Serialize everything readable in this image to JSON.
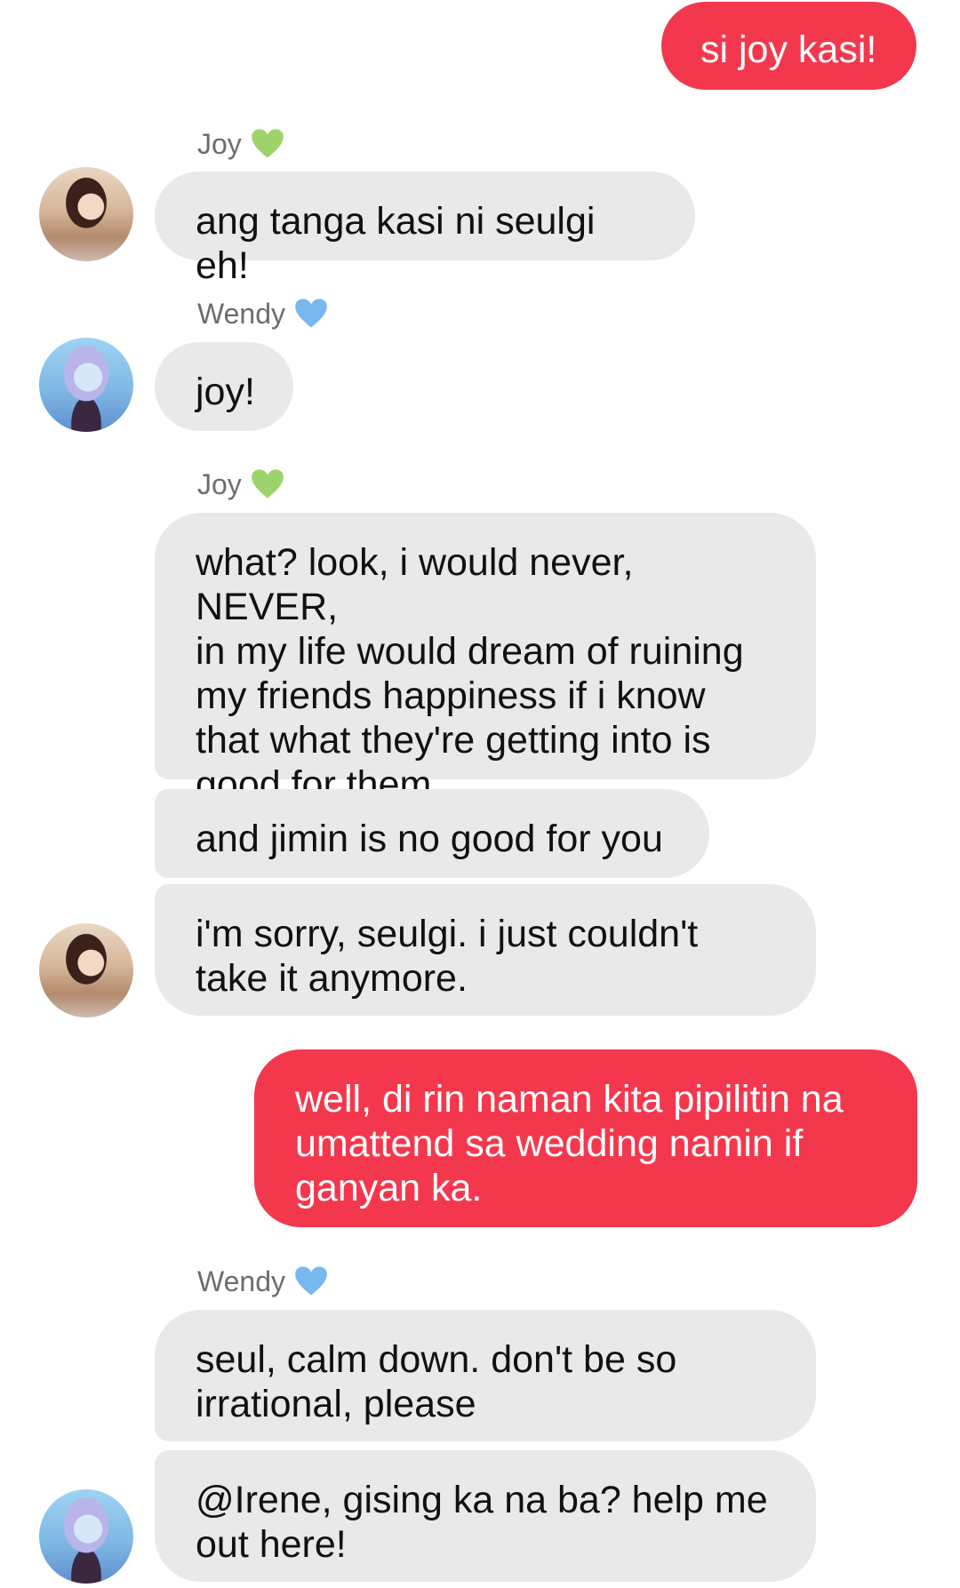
{
  "colors": {
    "outgoing_bubble": "#f3384e",
    "incoming_bubble": "#e9e9e9",
    "sender_name": "#6d6d6d",
    "joy_heart": "#9ed36b",
    "wendy_heart": "#79b8ef"
  },
  "messages": [
    {
      "type": "out",
      "text": "si joy kasi!"
    },
    {
      "type": "in",
      "sender": "Joy",
      "heart_icon": "green-heart-icon",
      "avatar_icon": "joy-avatar",
      "text": "ang tanga kasi ni seulgi eh!"
    },
    {
      "type": "in",
      "sender": "Wendy",
      "heart_icon": "blue-heart-icon",
      "avatar_icon": "wendy-avatar",
      "text": "joy!"
    },
    {
      "type": "in-group",
      "sender": "Joy",
      "heart_icon": "green-heart-icon",
      "avatar_icon": "joy-avatar",
      "texts": [
        "what? look, i would never, NEVER,\nin my life would dream of ruining\nmy friends happiness if i know\nthat what they're getting into is\ngood for them.",
        "and jimin is no good for you",
        "i'm sorry, seulgi. i just couldn't\ntake it anymore."
      ]
    },
    {
      "type": "out",
      "text": "well, di rin naman kita pipilitin na\numattend sa wedding namin if\nganyan ka."
    },
    {
      "type": "in-group",
      "sender": "Wendy",
      "heart_icon": "blue-heart-icon",
      "avatar_icon": "wendy-avatar",
      "texts": [
        "seul, calm down. don't be so\nirrational, please",
        "@Irene, gising ka na ba? help me\nout here!"
      ]
    }
  ]
}
